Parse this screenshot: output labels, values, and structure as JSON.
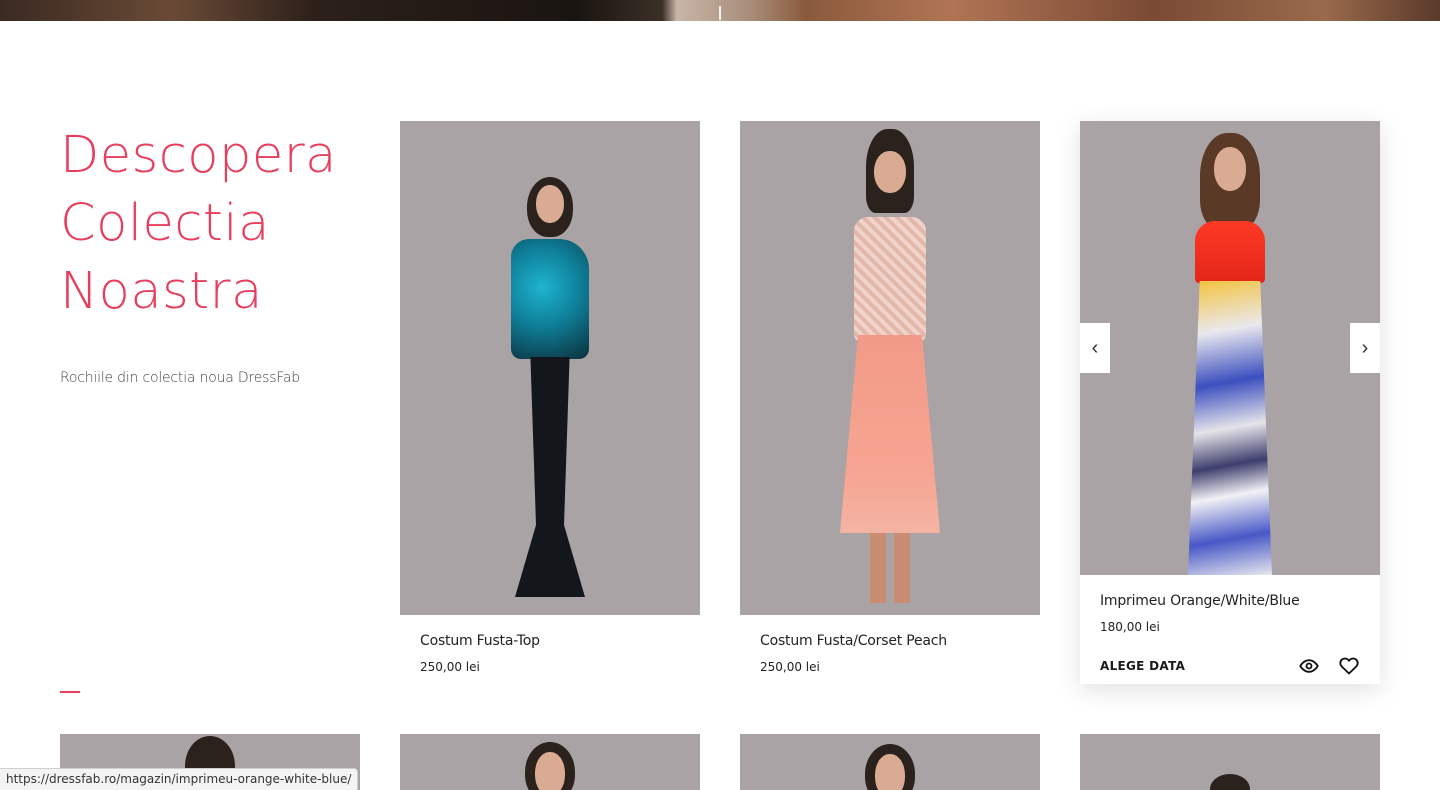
{
  "intro": {
    "title_lines": [
      "Descopera",
      "Colectia",
      "Noastra"
    ],
    "subtitle": "Rochiile din colectia noua DressFab"
  },
  "products": [
    {
      "name": "Costum Fusta-Top",
      "price": "250,00 lei"
    },
    {
      "name": "Costum Fusta/Corset Peach",
      "price": "250,00 lei"
    },
    {
      "name": "Imprimeu Orange/White/Blue",
      "price": "180,00 lei",
      "action_label": "ALEGE DATA"
    }
  ],
  "carousel": {
    "prev_symbol": "‹",
    "next_symbol": "›"
  },
  "status_url": "https://dressfab.ro/magazin/imprimeu-orange-white-blue/",
  "colors": {
    "accent": "#e63e5c",
    "image_bg": "#a9a3a5"
  },
  "icons": {
    "quick_view": "eye-icon",
    "wishlist": "heart-icon"
  }
}
